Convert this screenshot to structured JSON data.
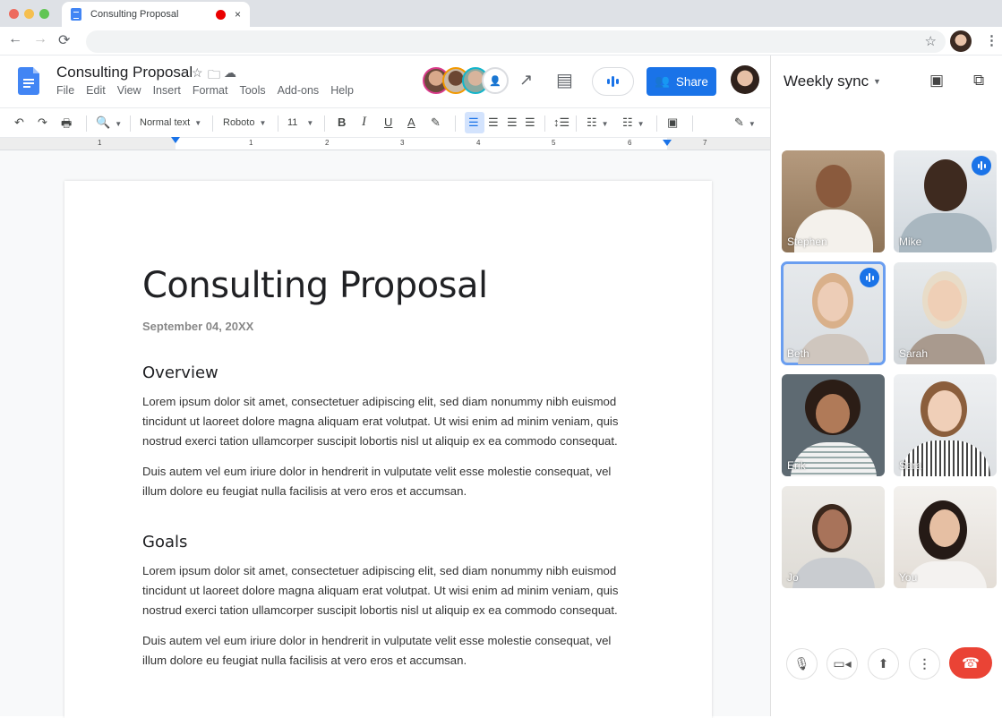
{
  "browser": {
    "tab_title": "Consulting Proposal",
    "tab_close": "×",
    "nav": {
      "back": "←",
      "forward": "→",
      "reload": "⟳"
    },
    "omnibox_value": "",
    "menu_icon": "⋮"
  },
  "docs": {
    "title": "Consulting Proposal",
    "title_icons": [
      "star-icon",
      "move-to-folder-icon",
      "cloud-saved-icon"
    ],
    "menu": [
      "File",
      "Edit",
      "View",
      "Insert",
      "Format",
      "Tools",
      "Add-ons",
      "Help"
    ],
    "share_label": "Share",
    "collaborators": [
      {
        "ring_color": "#d93a8a"
      },
      {
        "ring_color": "#f29900"
      },
      {
        "ring_color": "#12b5cb"
      }
    ],
    "toolbar": {
      "style": "Normal text",
      "font": "Roboto",
      "size": "11"
    },
    "ruler_numbers": [
      "1",
      "1",
      "2",
      "3",
      "4",
      "5",
      "6",
      "7"
    ],
    "page": {
      "title": "Consulting Proposal",
      "date": "September 04, 20XX",
      "sections": [
        {
          "heading": "Overview",
          "paragraphs": [
            "Lorem ipsum dolor sit amet, consectetuer adipiscing elit, sed diam nonummy nibh euismod tincidunt ut laoreet dolore magna aliquam erat volutpat. Ut wisi enim ad minim veniam, quis nostrud exerci tation ullamcorper suscipit lobortis nisl ut aliquip ex ea commodo consequat.",
            "Duis autem vel eum iriure dolor in hendrerit in vulputate velit esse molestie consequat, vel illum dolore eu feugiat nulla facilisis at vero eros et accumsan."
          ]
        },
        {
          "heading": "Goals",
          "paragraphs": [
            "Lorem ipsum dolor sit amet, consectetuer adipiscing elit, sed diam nonummy nibh euismod tincidunt ut laoreet dolore magna aliquam erat volutpat. Ut wisi enim ad minim veniam, quis nostrud exerci tation ullamcorper suscipit lobortis nisl ut aliquip ex ea commodo consequat.",
            "Duis autem vel eum iriure dolor in hendrerit in vulputate velit esse molestie consequat, vel illum dolore eu feugiat nulla facilisis at vero eros et accumsan."
          ]
        }
      ]
    }
  },
  "meet": {
    "title": "Weekly sync",
    "participants": [
      {
        "name": "Stephen",
        "speaking": false,
        "active": false
      },
      {
        "name": "Mike",
        "speaking": true,
        "active": false
      },
      {
        "name": "Beth",
        "speaking": true,
        "active": true
      },
      {
        "name": "Sarah",
        "speaking": false,
        "active": false
      },
      {
        "name": "Erik",
        "speaking": false,
        "active": false
      },
      {
        "name": "Sara",
        "speaking": false,
        "active": false
      },
      {
        "name": "Jo",
        "speaking": false,
        "active": false
      },
      {
        "name": "You",
        "speaking": false,
        "active": false
      }
    ],
    "controls": [
      "microphone-icon",
      "camera-icon",
      "present-screen-icon",
      "more-options-icon",
      "hang-up-icon"
    ]
  },
  "colors": {
    "accent": "#1a73e8",
    "hangup": "#ea4335",
    "recording": "#ea0000"
  }
}
